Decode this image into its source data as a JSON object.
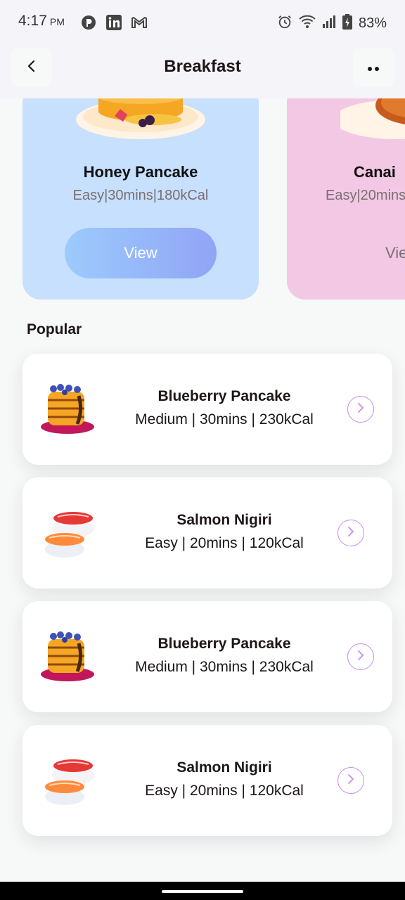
{
  "status_bar": {
    "time": "4:17",
    "ampm": "PM",
    "battery": "83%"
  },
  "header": {
    "title": "Breakfast",
    "back_icon": "chevron-left-icon",
    "more_icon": "more-dots-icon"
  },
  "categories": [
    {
      "title": "Honey Pancake",
      "meta": "Easy|30mins|180kCal",
      "button": "View"
    },
    {
      "title": "Canai",
      "meta": "Easy|20mins",
      "button": "View"
    }
  ],
  "popular": {
    "title": "Popular",
    "items": [
      {
        "name": "Blueberry Pancake",
        "meta": "Medium | 30mins | 230kCal",
        "image": "pancake"
      },
      {
        "name": "Salmon Nigiri",
        "meta": "Easy | 20mins | 120kCal",
        "image": "nigiri"
      },
      {
        "name": "Blueberry Pancake",
        "meta": "Medium | 30mins | 230kCal",
        "image": "pancake"
      },
      {
        "name": "Salmon Nigiri",
        "meta": "Easy | 20mins | 120kCal",
        "image": "nigiri"
      }
    ]
  },
  "colors": {
    "accent": "#c58bf2",
    "card_blue": "#c6e0fd",
    "card_pink": "#f2c8e4",
    "button_start": "#9ccbfc",
    "button_end": "#91a4f6"
  }
}
